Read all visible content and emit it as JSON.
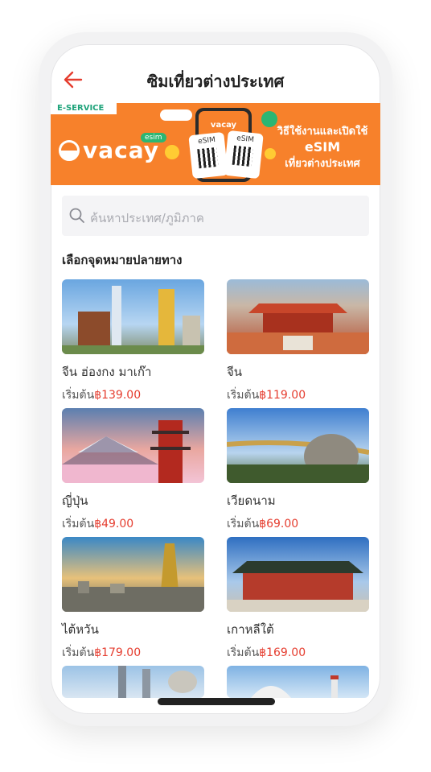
{
  "header": {
    "title": "ซิมเที่ยวต่างประเทศ",
    "back_icon": "arrow-left-icon"
  },
  "banner": {
    "tag": "E-SERVICE",
    "brand": "vacay",
    "brand_tag": "esim",
    "line1": "วิธีใช้งานและเปิดใช้",
    "line2": "eSIM",
    "line3": "เที่ยวต่างประเทศ",
    "card_label": "eSIM",
    "phone_brand": "vacay"
  },
  "search": {
    "placeholder": "ค้นหาประเทศ/ภูมิภาค"
  },
  "section": {
    "title": "เลือกจุดหมายปลายทาง"
  },
  "destinations": [
    {
      "name": "จีน ฮ่องกง มาเก๊า",
      "price_prefix": "เริ่มต้น",
      "price": "฿139.00"
    },
    {
      "name": "จีน",
      "price_prefix": "เริ่มต้น",
      "price": "฿119.00"
    },
    {
      "name": "ญี่ปุ่น",
      "price_prefix": "เริ่มต้น",
      "price": "฿49.00"
    },
    {
      "name": "เวียดนาม",
      "price_prefix": "เริ่มต้น",
      "price": "฿69.00"
    },
    {
      "name": "ไต้หวัน",
      "price_prefix": "เริ่มต้น",
      "price": "฿179.00"
    },
    {
      "name": "เกาหลีใต้",
      "price_prefix": "เริ่มต้น",
      "price": "฿169.00"
    }
  ],
  "colors": {
    "accent": "#e53d2f",
    "banner": "#f7812b",
    "green": "#2bb673"
  }
}
